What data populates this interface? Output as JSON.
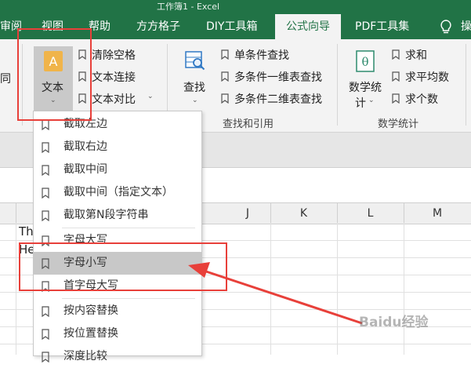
{
  "window": {
    "title": "工作簿1 - Excel"
  },
  "tabs": [
    {
      "label": "审阅",
      "active": false
    },
    {
      "label": "视图",
      "active": false
    },
    {
      "label": "帮助",
      "active": false
    },
    {
      "label": "方方格子",
      "active": false
    },
    {
      "label": "DIY工具箱",
      "active": false
    },
    {
      "label": "公式向导",
      "active": true
    },
    {
      "label": "PDF工具集",
      "active": false
    },
    {
      "label": "操",
      "active": false
    }
  ],
  "ribbon": {
    "left_partial_label": "同",
    "text_button": {
      "label": "文本",
      "icon": "text-a-icon"
    },
    "text_items": [
      "清除空格",
      "文本连接",
      "文本对比"
    ],
    "find_button": {
      "label": "查找",
      "icon": "find-table-icon"
    },
    "find_items": [
      "单条件查找",
      "多条件一维表查找",
      "多条件二维表查找"
    ],
    "find_group_title": "查找和引用",
    "math_button": {
      "label_line1": "数学统",
      "label_line2": "计",
      "icon": "theta-icon"
    },
    "math_items": [
      "求和",
      "求平均数",
      "求个数"
    ],
    "math_group_title": "数学统计"
  },
  "sheet": {
    "columns": [
      "J",
      "K",
      "L",
      "M"
    ],
    "cells": [
      "Th",
      "He"
    ]
  },
  "dropdown": {
    "items": [
      "截取左边",
      "截取右边",
      "截取中间",
      "截取中间（指定文本）",
      "截取第N段字符串",
      "字母大写",
      "字母小写",
      "首字母大写",
      "按内容替换",
      "按位置替换",
      "深度比较"
    ],
    "highlighted_index": 6
  },
  "annotation": {
    "color": "#e8403a",
    "watermark": "Baidu经验"
  },
  "colors": {
    "brand": "#217346",
    "ribbon_bg": "#f3f3f3",
    "highlight": "#c8c8c8"
  }
}
